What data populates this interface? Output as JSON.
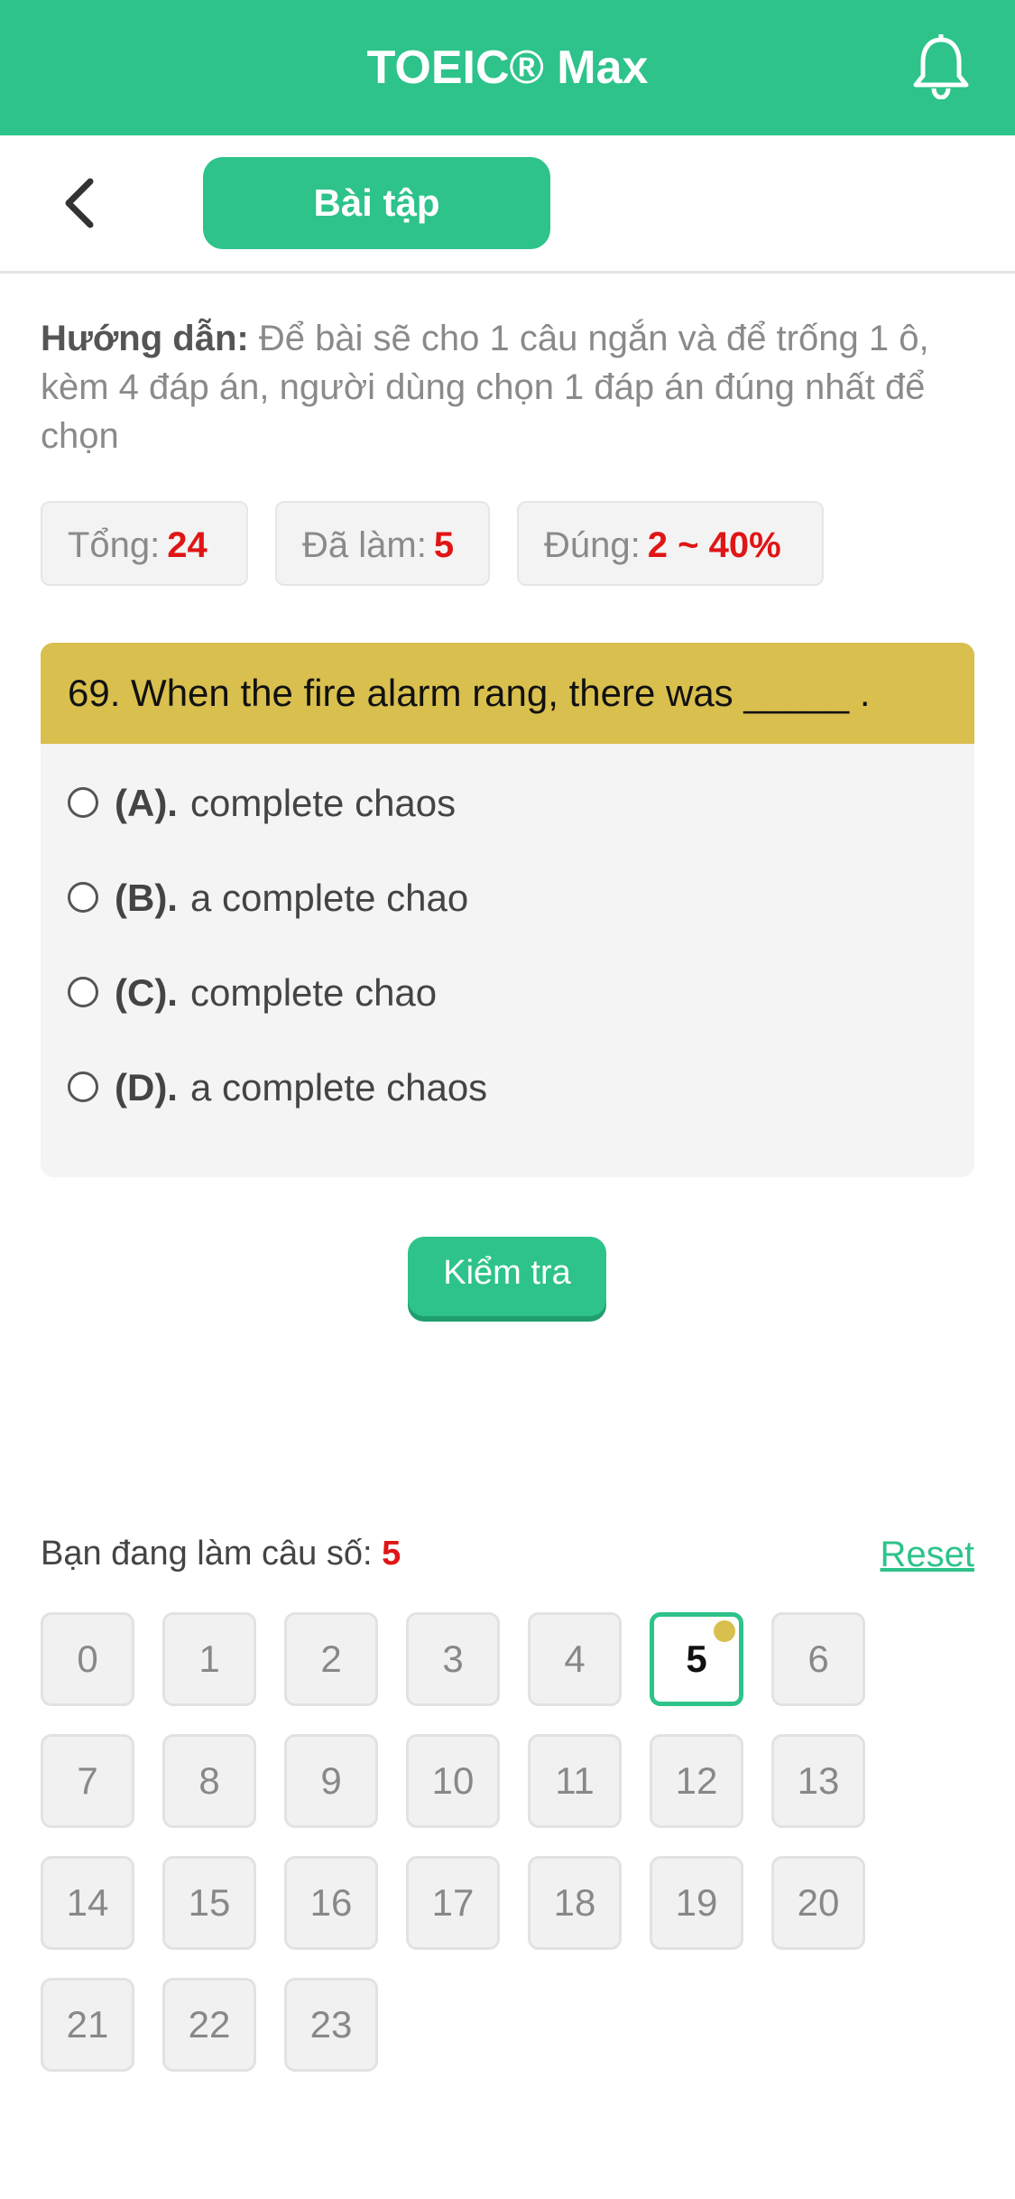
{
  "header": {
    "title": "TOEIC® Max",
    "bell_icon": "bell-icon",
    "color": "#2dc38a"
  },
  "subbar": {
    "back_icon": "chevron-left-icon",
    "tab_label": "Bài tập"
  },
  "instruction": {
    "label": "Hướng dẫn:",
    "text": " Để bài sẽ cho 1 câu ngắn và để trống 1 ô, kèm 4 đáp án, người dùng chọn 1 đáp án đúng nhất để chọn"
  },
  "stats": {
    "total_label": "Tổng:",
    "total_value": "24",
    "done_label": "Đã làm:",
    "done_value": "5",
    "correct_label": "Đúng:",
    "correct_value": "2 ~ 40%"
  },
  "question": {
    "text": "69. When the fire alarm rang, there was _____ .",
    "options": [
      {
        "letter": "(A).",
        "text": "complete chaos"
      },
      {
        "letter": "(B).",
        "text": "a complete chao"
      },
      {
        "letter": "(C).",
        "text": "complete chao"
      },
      {
        "letter": "(D).",
        "text": "a complete chaos"
      }
    ]
  },
  "check_button": "Kiểm tra",
  "progress": {
    "label": "Bạn đang làm câu số:",
    "current": "5",
    "reset_label": "Reset"
  },
  "question_numbers": [
    "0",
    "1",
    "2",
    "3",
    "4",
    "5",
    "6",
    "7",
    "8",
    "9",
    "10",
    "11",
    "12",
    "13",
    "14",
    "15",
    "16",
    "17",
    "18",
    "19",
    "20",
    "21",
    "22",
    "23"
  ],
  "current_index": 5,
  "accent_yellow": "#d9bf4e",
  "accent_red": "#e01515"
}
